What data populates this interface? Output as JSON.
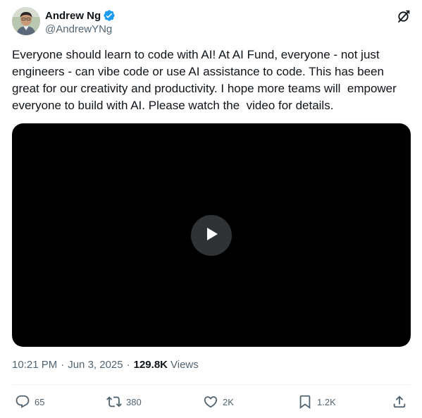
{
  "author": {
    "display_name": "Andrew Ng",
    "handle": "@AndrewYNg",
    "verified": true,
    "verified_color": "#1d9bf0"
  },
  "tweet": {
    "text": "Everyone should learn to code with AI! At AI Fund, everyone - not just engineers - can vibe code or use AI assistance to code. This has been great for our creativity and productivity. I hope more teams will  empower everyone to build with AI. Please watch the  video for details."
  },
  "media": {
    "type": "video",
    "play_icon": "play-icon"
  },
  "meta": {
    "time": "10:21 PM",
    "separator": "·",
    "date": "Jun 3, 2025",
    "views_count": "129.8K",
    "views_label": "Views"
  },
  "actions": {
    "replies": "65",
    "reposts": "380",
    "likes": "2K",
    "bookmarks": "1.2K"
  },
  "icons": {
    "grok": "grok-icon",
    "reply": "reply-icon",
    "repost": "repost-icon",
    "like": "heart-icon",
    "bookmark": "bookmark-icon",
    "share": "share-icon"
  },
  "colors": {
    "text_primary": "#0f1419",
    "text_secondary": "#536471",
    "video_bg": "#000000",
    "divider": "#eff3f4"
  }
}
